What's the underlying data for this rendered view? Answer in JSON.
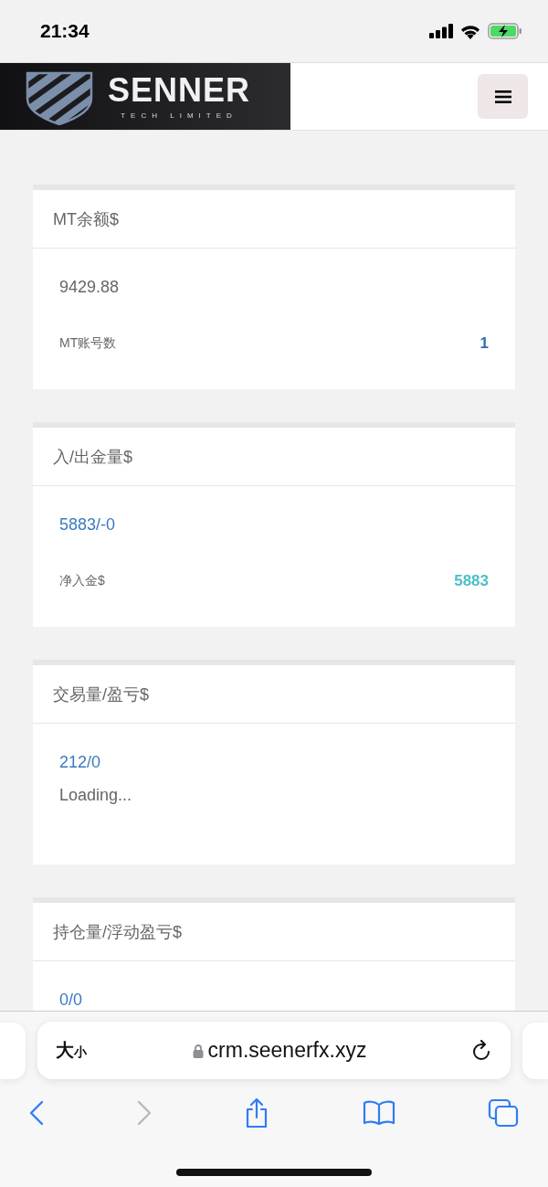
{
  "status_bar": {
    "time": "21:34"
  },
  "header": {
    "logo_name": "SENNER",
    "logo_tagline": "TECH LIMITED"
  },
  "cards": [
    {
      "title": "MT余额$",
      "value": "9429.88",
      "color": "#666666",
      "row": {
        "label": "MT账号数",
        "value": "1",
        "color": "#2f6eb0"
      }
    },
    {
      "title": "入/出金量$",
      "value": "5883/-0",
      "color": "#3a7bc0",
      "row": {
        "label": "净入金$",
        "value": "5883",
        "color": "#4dbfc4"
      }
    },
    {
      "title": "交易量/盈亏$",
      "value": "212/0",
      "color": "#3a7bc0",
      "status": "Loading..."
    },
    {
      "title": "持仓量/浮动盈亏$",
      "value": "0/0",
      "color": "#3a7bc0"
    }
  ],
  "browser": {
    "text_size": "大小",
    "url": "crm.seenerfx.xyz"
  }
}
